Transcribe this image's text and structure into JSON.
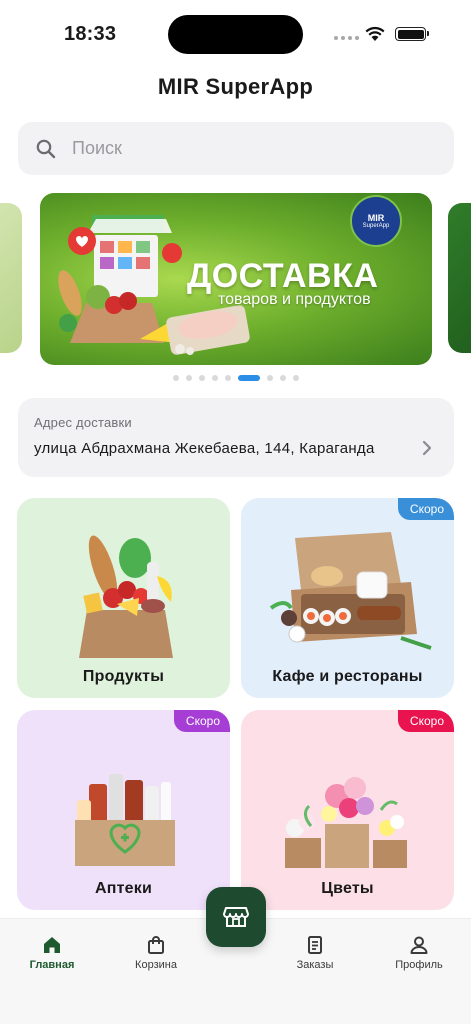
{
  "status_bar": {
    "time": "18:33"
  },
  "app": {
    "title": "MIR SuperApp"
  },
  "search": {
    "placeholder": "Поиск",
    "value": ""
  },
  "banner": {
    "headline": "ДОСТАВКА",
    "subtitle": "товаров и продуктов",
    "logo_line1": "MIR",
    "logo_line2": "SuperApp",
    "dots_total": 9,
    "active_index": 5
  },
  "address": {
    "label": "Адрес доставки",
    "value": "улица Абдрахмана Жекебаева, 144, Караганда"
  },
  "categories": [
    {
      "label": "Продукты",
      "badge": "",
      "bg": "#dff2dc",
      "badge_color": ""
    },
    {
      "label": "Кафе и рестораны",
      "badge": "Скоро",
      "bg": "#e3eefb",
      "badge_color": "#3a8fd9"
    },
    {
      "label": "Аптеки",
      "badge": "Скоро",
      "bg": "#f0e1fb",
      "badge_color": "#a63ed6"
    },
    {
      "label": "Цветы",
      "badge": "Скоро",
      "bg": "#fde0e7",
      "badge_color": "#e8134f"
    }
  ],
  "tabbar": {
    "items": [
      {
        "label": "Главная",
        "icon": "home-icon",
        "active": true
      },
      {
        "label": "Корзина",
        "icon": "shopping-bag-icon",
        "active": false
      },
      {
        "label": "Заказы",
        "icon": "orders-icon",
        "active": false
      },
      {
        "label": "Профиль",
        "icon": "profile-icon",
        "active": false
      }
    ],
    "center_icon": "store-icon"
  },
  "colors": {
    "accent": "#1e4a2f",
    "dot_active": "#2a8ee6"
  }
}
